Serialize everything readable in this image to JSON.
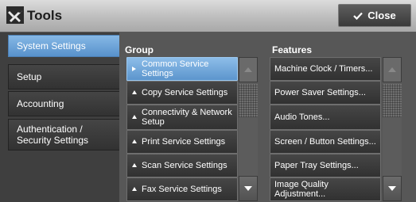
{
  "window": {
    "title": "Tools",
    "icon": "tools-icon",
    "close_label": "Close"
  },
  "nav": {
    "items": [
      {
        "label": "System Settings",
        "selected": true
      },
      {
        "label": "Setup",
        "selected": false
      },
      {
        "label": "Accounting",
        "selected": false
      },
      {
        "label": "Authentication / Security Settings",
        "selected": false
      }
    ]
  },
  "group": {
    "header": "Group",
    "items": [
      {
        "label": "Common Service Settings",
        "selected": true
      },
      {
        "label": "Copy Service Settings",
        "selected": false
      },
      {
        "label": "Connectivity & Network Setup",
        "selected": false
      },
      {
        "label": "Print Service Settings",
        "selected": false
      },
      {
        "label": "Scan Service Settings",
        "selected": false
      },
      {
        "label": "Fax Service Settings",
        "selected": false
      }
    ]
  },
  "features": {
    "header": "Features",
    "items": [
      {
        "label": "Machine Clock / Timers..."
      },
      {
        "label": "Power Saver Settings..."
      },
      {
        "label": "Audio Tones..."
      },
      {
        "label": "Screen / Button Settings..."
      },
      {
        "label": "Paper Tray Settings..."
      },
      {
        "label": "Image Quality Adjustment..."
      }
    ]
  },
  "colors": {
    "accent": "#6fa5db",
    "background": "#575757"
  }
}
